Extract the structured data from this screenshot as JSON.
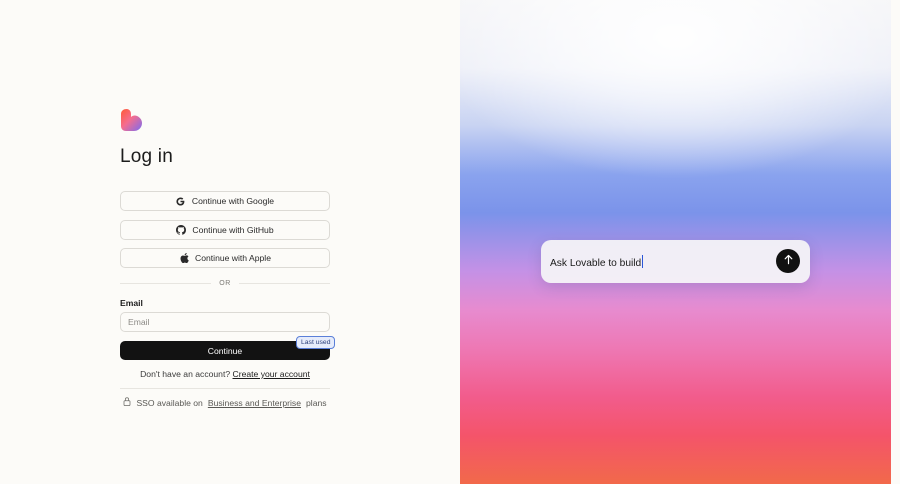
{
  "login": {
    "title": "Log in",
    "oauth": {
      "google_label": "Continue with Google",
      "github_label": "Continue with GitHub",
      "apple_label": "Continue with Apple"
    },
    "divider_label": "OR",
    "email": {
      "label": "Email",
      "placeholder": "Email",
      "value": ""
    },
    "continue_label": "Continue",
    "last_used_badge": "Last used",
    "signup": {
      "prefix": "Don't have an account?",
      "link": "Create your account"
    },
    "sso": {
      "prefix": "SSO available on",
      "link": "Business and Enterprise",
      "suffix": "plans"
    }
  },
  "hero": {
    "prompt_text": "Ask Lovable to build"
  },
  "icons": {
    "logo": "lovable-heart-logo",
    "google": "google-icon",
    "github": "github-icon",
    "apple": "apple-icon",
    "lock": "lock-icon",
    "send": "arrow-up-icon"
  },
  "colors": {
    "page_background": "#fcfbf8",
    "primary_button": "#121212",
    "badge_border": "#5a7fd8",
    "badge_background": "#e6ecfb",
    "caret": "#2b56d8"
  }
}
